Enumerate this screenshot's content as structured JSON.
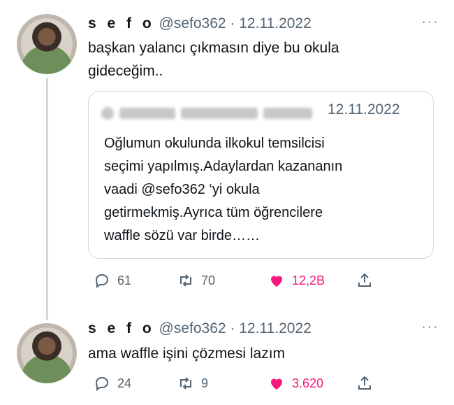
{
  "tweets": [
    {
      "author_name": "s e f o",
      "meta": "@sefo362 · 12.11.2022",
      "more": "···",
      "text_lines": [
        "başkan yalancı çıkmasın diye bu okula",
        "gideceğim.."
      ],
      "quote": {
        "date": "12.11.2022",
        "text_lines": [
          "Oğlumun okulunda ilkokul temsilcisi",
          "seçimi yapılmış.Adaylardan kazananın",
          "vaadi @sefo362 ‘yi okula",
          "getirmekmiş.Ayrıca tüm öğrencilere",
          "waffle sözü var birde……"
        ]
      },
      "replies": "61",
      "retweets": "70",
      "likes": "12,2B"
    },
    {
      "author_name": "s e f o",
      "meta": "@sefo362 · 12.11.2022",
      "more": "···",
      "text_lines": [
        "ama waffle işini çözmesi lazım"
      ],
      "replies": "24",
      "retweets": "9",
      "likes": "3.620"
    }
  ],
  "colors": {
    "like": "#f91880",
    "muted": "#536471",
    "border": "#cfd9de"
  },
  "icons": [
    "reply-icon",
    "retweet-icon",
    "heart-icon",
    "share-icon",
    "more-icon"
  ]
}
